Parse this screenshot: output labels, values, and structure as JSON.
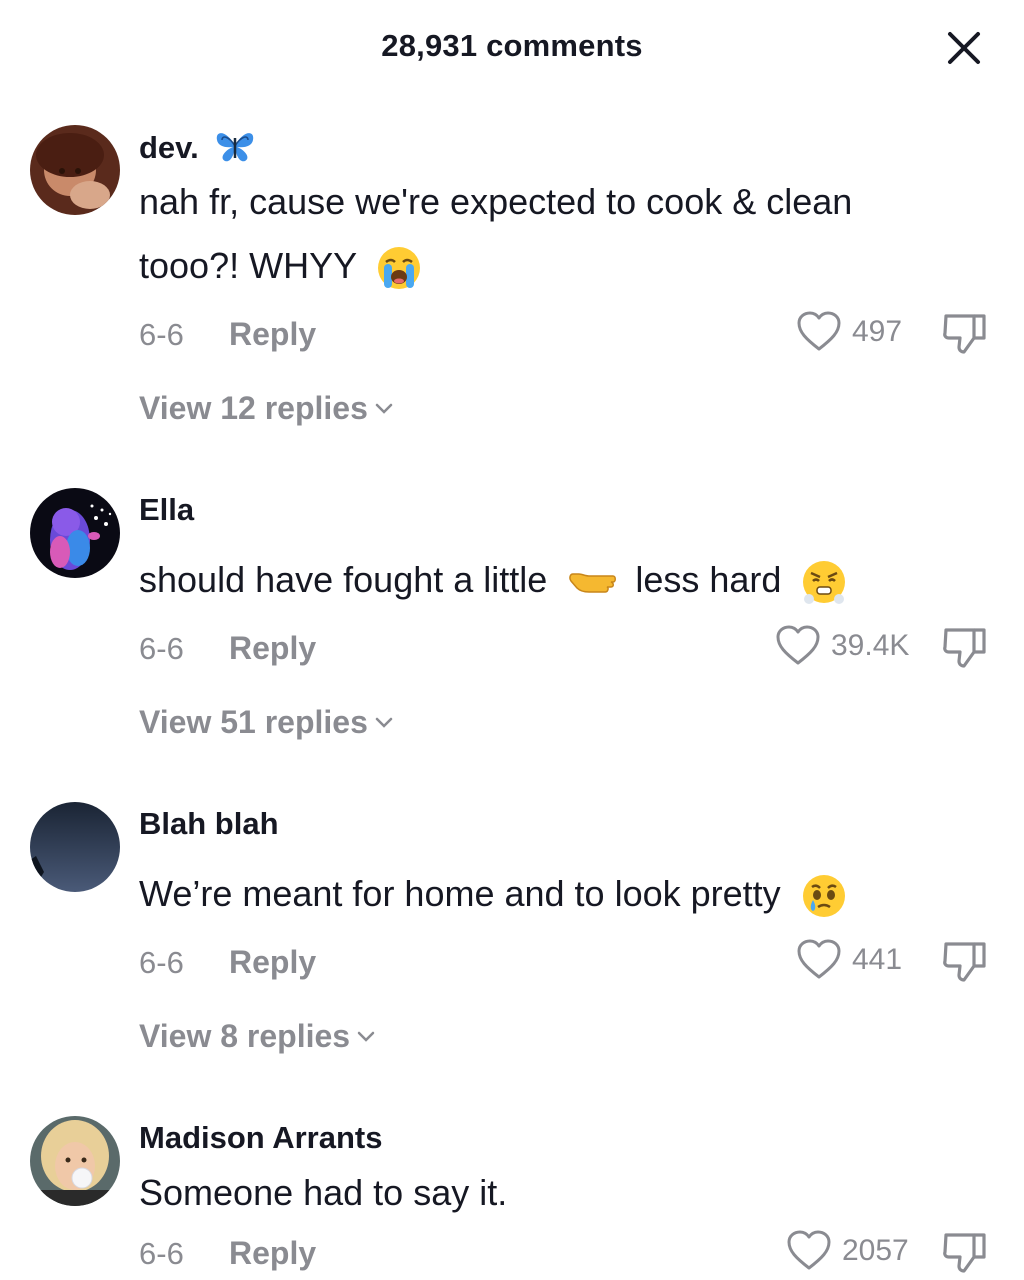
{
  "header": {
    "title": "28,931 comments"
  },
  "comments": [
    {
      "username": "dev.",
      "text_line1": "nah fr, cause we're expected to cook & clean",
      "text_line2": "tooo?! WHYY",
      "date": "6-6",
      "reply_label": "Reply",
      "likes": "497",
      "view_replies": "View 12 replies",
      "icons": [
        "butterfly-emoji",
        "crying-face-emoji"
      ]
    },
    {
      "username": "Ella",
      "text_part1": "should have fought a little",
      "text_part2": "less hard",
      "date": "6-6",
      "reply_label": "Reply",
      "likes": "39.4K",
      "view_replies": "View 51 replies",
      "icons": [
        "pointing-hand-emoji",
        "huffing-face-emoji"
      ]
    },
    {
      "username": "Blah blah",
      "text": "We’re meant for home and to look pretty",
      "date": "6-6",
      "reply_label": "Reply",
      "likes": "441",
      "view_replies": "View 8 replies",
      "icons": [
        "holding-back-tears-emoji"
      ]
    },
    {
      "username": "Madison Arrants",
      "text": "Someone had to say it.",
      "date": "6-6",
      "reply_label": "Reply",
      "likes": "2057"
    }
  ],
  "colors": {
    "primary_text": "#161823",
    "secondary_text": "#8a8b91"
  }
}
